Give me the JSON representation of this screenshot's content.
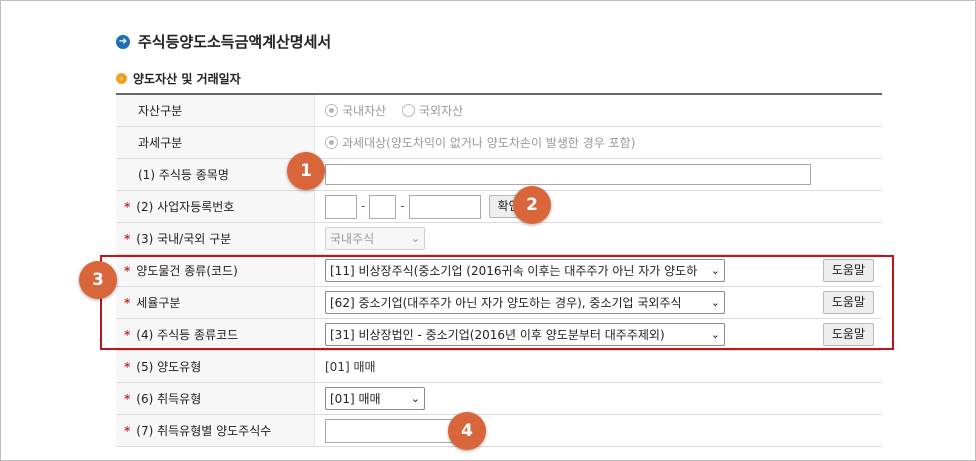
{
  "page_title": "주식등양도소득금액계산명세서",
  "section_title": "양도자산 및 거래일자",
  "rows": [
    {
      "label": "자산구분",
      "radios": [
        {
          "label": "국내자산",
          "checked": true
        },
        {
          "label": "국외자산",
          "checked": false
        }
      ]
    },
    {
      "label": "과세구분",
      "radio_label": "과세대상(양도차익이 없거나 양도차손이 발생한 경우 포함)"
    },
    {
      "label": "(1) 주식등 종목명"
    },
    {
      "label": "(2) 사업자등록번호",
      "button": "확인"
    },
    {
      "label": "(3) 국내/국외 구분",
      "select": "국내주식"
    },
    {
      "label": "양도물건 종류(코드)",
      "select": "[11] 비상장주식(중소기업 (2016귀속 이후는 대주주가 아닌 자가 양도하",
      "help": "도움말"
    },
    {
      "label": "세율구분",
      "select": "[62] 중소기업(대주주가 아닌 자가 양도하는 경우), 중소기업 국외주식",
      "help": "도움말"
    },
    {
      "label": "(4) 주식등 종류코드",
      "select": "[31] 비상장법인 - 중소기업(2016년 이후 양도분부터 대주주제외)",
      "help": "도움말"
    },
    {
      "label": "(5) 양도유형",
      "value": "[01] 매매"
    },
    {
      "label": "(6) 취득유형",
      "select": "[01] 매매"
    },
    {
      "label": "(7) 취득유형별 양도주식수"
    }
  ],
  "badges": [
    "1",
    "2",
    "3",
    "4"
  ],
  "colors": {
    "accent": "#1f6fb7",
    "required": "#c0392b",
    "highlight_box": "#c0141c",
    "badge": "#d9653a"
  }
}
